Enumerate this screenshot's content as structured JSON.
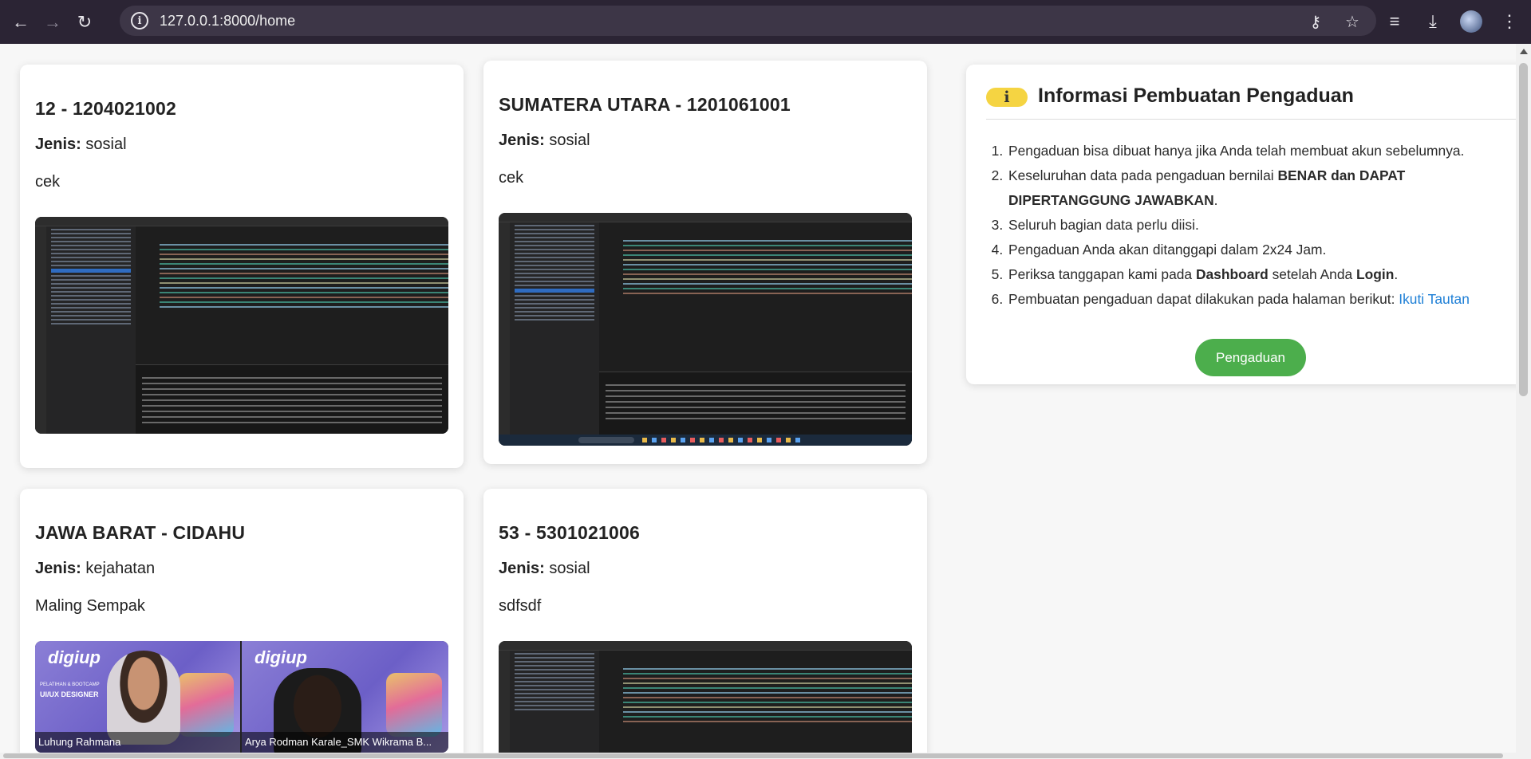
{
  "browser": {
    "url": "127.0.0.1:8000/home",
    "icons": [
      "back-icon",
      "forward-icon",
      "reload-icon",
      "site-info-icon",
      "password-key-icon",
      "bookmark-star-icon",
      "media-control-icon",
      "download-icon",
      "profile-avatar",
      "menu-icon"
    ]
  },
  "cards": [
    {
      "title": "12 - 1204021002",
      "jenis_label": "Jenis:",
      "jenis_value": "sosial",
      "description": "cek",
      "image": "code-editor-screenshot"
    },
    {
      "title": "SUMATERA UTARA - 1201061001",
      "jenis_label": "Jenis:",
      "jenis_value": "sosial",
      "description": "cek",
      "image": "code-editor-screenshot"
    },
    {
      "title": "JAWA BARAT - CIDAHU",
      "jenis_label": "Jenis:",
      "jenis_value": "kejahatan",
      "description": "Maling Sempak",
      "image": "video-call-screenshot",
      "video": {
        "logo": "digiup",
        "tag_small": "PELATIHAN & BOOTCAMP",
        "tag_big": "UI/UX DESIGNER",
        "participant_1": "Luhung Rahmana",
        "participant_2": "Arya Rodman Karale_SMK Wikrama B..."
      }
    },
    {
      "title": "53 - 5301021006",
      "jenis_label": "Jenis:",
      "jenis_value": "sosial",
      "description": "sdfsdf",
      "image": "code-editor-screenshot"
    }
  ],
  "info": {
    "badge": "i",
    "title": "Informasi Pembuatan Pengaduan",
    "items": [
      {
        "text": "Pengaduan bisa dibuat hanya jika Anda telah membuat akun sebelumnya."
      },
      {
        "pre": "Keseluruhan data pada pengaduan bernilai ",
        "bold": "BENAR dan DAPAT DIPERTANGGUNG JAWABKAN",
        "post": "."
      },
      {
        "text": "Seluruh bagian data perlu diisi."
      },
      {
        "text": "Pengaduan Anda akan ditanggapi dalam 2x24 Jam."
      },
      {
        "pre": "Periksa tanggapan kami pada ",
        "bold": "Dashboard",
        "mid": " setelah Anda ",
        "bold2": "Login",
        "post": "."
      },
      {
        "pre": "Pembuatan pengaduan dapat dilakukan pada halaman berikut: ",
        "link": "Ikuti Tautan"
      }
    ],
    "button": "Pengaduan",
    "colors": {
      "badge": "#f5d442",
      "button": "#4cae4c",
      "link": "#1e7fd6"
    }
  }
}
